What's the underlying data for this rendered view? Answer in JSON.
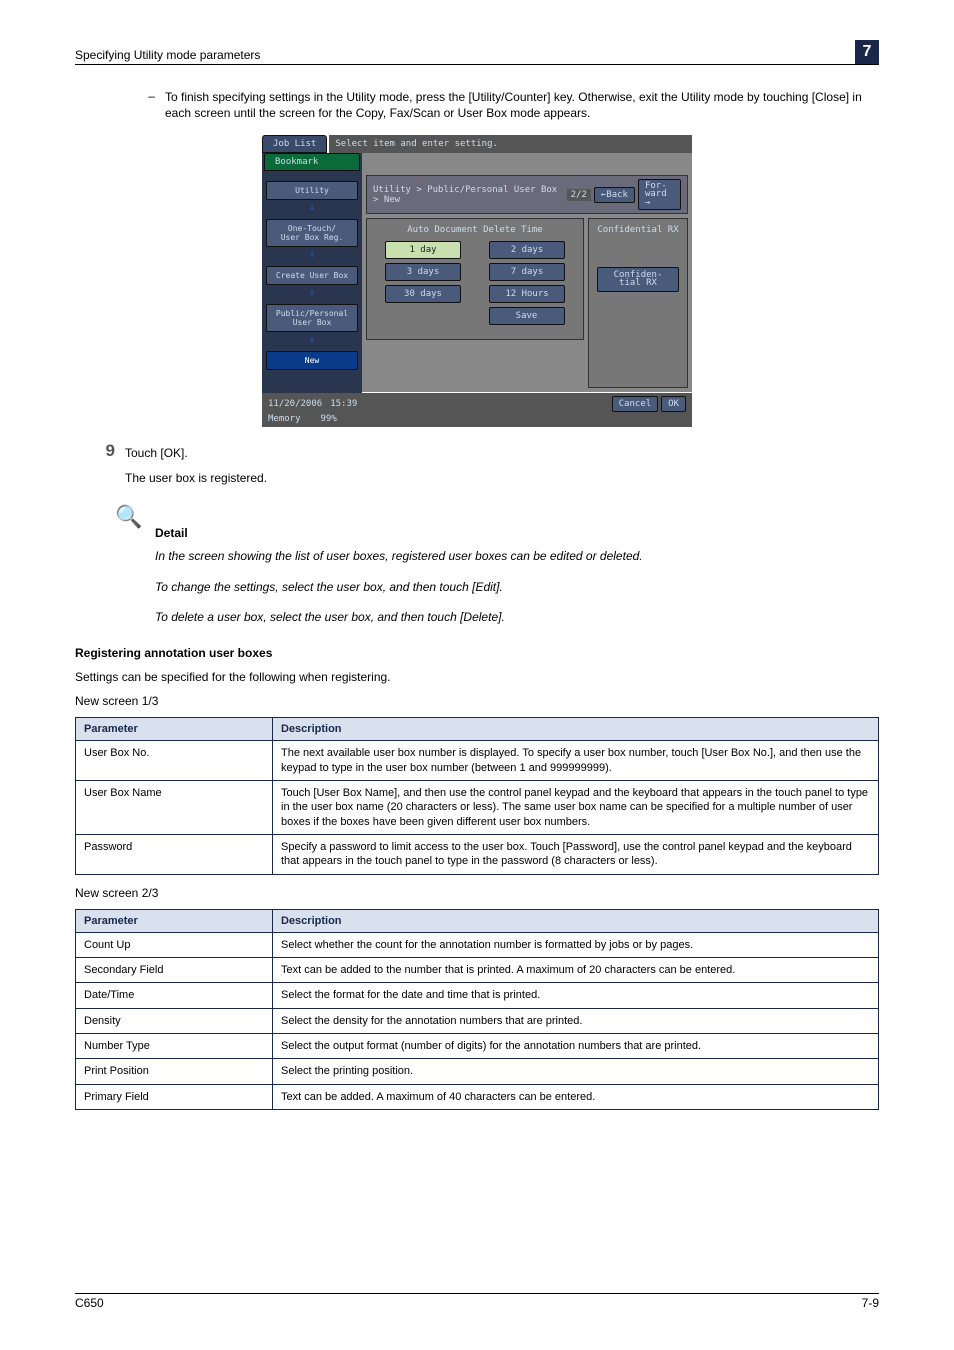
{
  "header": {
    "left": "Specifying Utility mode parameters",
    "right": "7"
  },
  "bullet": {
    "mark": "–",
    "text": "To finish specifying settings in the Utility mode, press the [Utility/Counter] key. Otherwise, exit the Utility mode by touching [Close] in each screen until the screen for the Copy, Fax/Scan or User Box mode appears."
  },
  "screenshot": {
    "tabs": {
      "joblist": "Job List",
      "bookmark": "Bookmark"
    },
    "topmsg": "Select item and enter setting.",
    "side": {
      "utility": "Utility",
      "onetouch": "One-Touch/\nUser Box Reg.",
      "create": "Create User Box",
      "pub": "Public/Personal\nUser Box",
      "new": "New"
    },
    "breadcrumb": "Utility > Public/Personal User Box > New",
    "page": "2/2",
    "back": "←Back",
    "forward": "For-\nward →",
    "panel_l_title": "Auto Document Delete Time",
    "panel_r_title": "Confidential RX",
    "options": {
      "d1": "1 day",
      "d2": "2 days",
      "d3": "3 days",
      "d7": "7 days",
      "d30": "30 days",
      "h12": "12 Hours",
      "save": "Save"
    },
    "confiden": "Confiden-\ntial RX",
    "status": {
      "date": "11/20/2006",
      "time": "15:39",
      "mem": "Memory",
      "memv": "99%"
    },
    "cancel": "Cancel",
    "ok": "OK"
  },
  "step9": {
    "num": "9",
    "text": "Touch [OK].",
    "sub": "The user box is registered."
  },
  "detail": {
    "icon": "🔍",
    "heading": "Detail",
    "p1": "In the screen showing the list of user boxes, registered user boxes can be edited or deleted.",
    "p2": "To change the settings, select the user box, and then touch [Edit].",
    "p3": "To delete a user box, select the user box, and then touch [Delete]."
  },
  "sec": {
    "title": "Registering annotation user boxes",
    "intro": "Settings can be specified for the following when registering.",
    "cap1": "New screen 1/3",
    "cap2": "New screen 2/3"
  },
  "tbl1": {
    "h1": "Parameter",
    "h2": "Description",
    "rows": [
      {
        "p": "User Box No.",
        "d": "The next available user box number is displayed. To specify a user box number, touch [User Box No.], and then use the keypad to type in the user box number (between 1 and 999999999)."
      },
      {
        "p": "User Box Name",
        "d": "Touch [User Box Name], and then use the control panel keypad and the keyboard that appears in the touch panel to type in the user box name (20 characters or less). The same user box name can be specified for a multiple number of user boxes if the boxes have been given different user box numbers."
      },
      {
        "p": "Password",
        "d": "Specify a password to limit access to the user box. Touch [Password], use the control panel keypad and the keyboard that appears in the touch panel to type in the password (8 characters or less)."
      }
    ]
  },
  "tbl2": {
    "h1": "Parameter",
    "h2": "Description",
    "rows": [
      {
        "p": "Count Up",
        "d": "Select whether the count for the annotation number is formatted by jobs or by pages."
      },
      {
        "p": "Secondary Field",
        "d": "Text can be added to the number that is printed. A maximum of 20 characters can be entered."
      },
      {
        "p": "Date/Time",
        "d": "Select the format for the date and time that is printed."
      },
      {
        "p": "Density",
        "d": "Select the density for the annotation numbers that are printed."
      },
      {
        "p": "Number Type",
        "d": "Select the output format (number of digits) for the annotation numbers that are printed."
      },
      {
        "p": "Print Position",
        "d": "Select the printing position."
      },
      {
        "p": "Primary Field",
        "d": "Text can be added. A maximum of 40 characters can be entered."
      }
    ]
  },
  "footer": {
    "left": "C650",
    "right": "7-9"
  }
}
